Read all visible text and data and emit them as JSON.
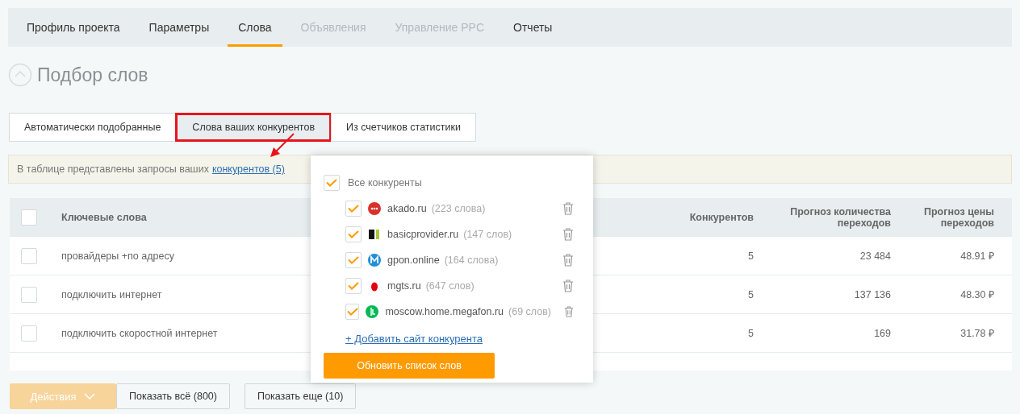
{
  "nav_tabs": [
    {
      "label": "Профиль проекта",
      "selected": false,
      "disabled": false
    },
    {
      "label": "Параметры",
      "selected": false,
      "disabled": false
    },
    {
      "label": "Слова",
      "selected": true,
      "disabled": false
    },
    {
      "label": "Объявления",
      "selected": false,
      "disabled": true
    },
    {
      "label": "Управление PPC",
      "selected": false,
      "disabled": true
    },
    {
      "label": "Отчеты",
      "selected": false,
      "disabled": false
    }
  ],
  "section": {
    "title": "Подбор слов",
    "expanded": true
  },
  "source_tabs": [
    {
      "label": "Автоматически подобранные",
      "selected": false
    },
    {
      "label": "Слова ваших конкурентов",
      "selected": true
    },
    {
      "label": "Из счетчиков статистики",
      "selected": false
    }
  ],
  "info": {
    "text": "В таблице представлены запросы ваших",
    "link": "конкурентов (5)"
  },
  "table": {
    "select_all_checked": false,
    "columns": [
      "Ключевые слова",
      "Конкурентов",
      "Прогноз количества переходов",
      "Прогноз цены переходов"
    ],
    "rows": [
      {
        "checked": false,
        "keyword": "провайдеры +по адресу",
        "competitors": "5",
        "clicks": "23 484",
        "price": "48.91 ₽"
      },
      {
        "checked": false,
        "keyword": "подключить интернет",
        "competitors": "5",
        "clicks": "137 136",
        "price": "48.30 ₽"
      },
      {
        "checked": false,
        "keyword": "подключить скоростной интернет",
        "competitors": "5",
        "clicks": "169",
        "price": "31.78 ₽"
      }
    ]
  },
  "footer": {
    "actions": {
      "label": "Действия",
      "disabled": true
    },
    "show_all": "Показать всё (800)",
    "show_more": "Показать еще (10)"
  },
  "popup": {
    "all": {
      "label": "Все конкуренты",
      "checked": true
    },
    "competitors": [
      {
        "site": "akado.ru",
        "count": "(223 слова)",
        "checked": true,
        "kind": "akado",
        "color": "#d9322b"
      },
      {
        "site": "basicprovider.ru",
        "count": "(147 слов)",
        "checked": true,
        "kind": "basic",
        "color": "#a6c93a"
      },
      {
        "site": "gpon.online",
        "count": "(164 слова)",
        "checked": true,
        "kind": "gpon",
        "color": "#1e8fd6"
      },
      {
        "site": "mgts.ru",
        "count": "(647 слов)",
        "checked": true,
        "kind": "mgts",
        "color": "#e3000f"
      },
      {
        "site": "moscow.home.megafon.ru",
        "count": "(69 слов)",
        "checked": true,
        "kind": "megafon",
        "color": "#00b956"
      }
    ],
    "add_link": "+ Добавить сайт конкурента",
    "update_button": "Обновить список слов"
  }
}
